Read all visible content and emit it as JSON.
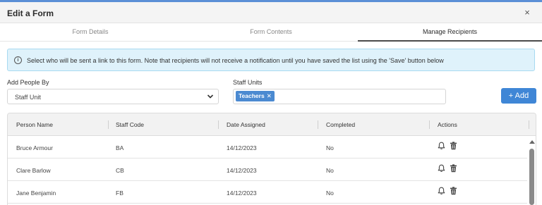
{
  "modal": {
    "title": "Edit a Form",
    "close_label": "×"
  },
  "tabs": [
    {
      "label": "Form Details",
      "active": false
    },
    {
      "label": "Form Contents",
      "active": false
    },
    {
      "label": "Manage Recipients",
      "active": true
    }
  ],
  "info": {
    "icon": "info-circle-icon",
    "text": "Select who will be sent a link to this form. Note that recipients will not receive a notification until you have saved the list using the 'Save' button below"
  },
  "add_people_by": {
    "label": "Add People By",
    "value": "Staff Unit"
  },
  "staff_units": {
    "label": "Staff Units",
    "tags": [
      "Teachers"
    ]
  },
  "add_button": {
    "label": "+ Add"
  },
  "table": {
    "columns": [
      "Person Name",
      "Staff Code",
      "Date Assigned",
      "Completed",
      "Actions"
    ],
    "rows": [
      {
        "name": "Bruce Armour",
        "code": "BA",
        "date": "14/12/2023",
        "completed": "No"
      },
      {
        "name": "Clare Barlow",
        "code": "CB",
        "date": "14/12/2023",
        "completed": "No"
      },
      {
        "name": "Jane Benjamin",
        "code": "FB",
        "date": "14/12/2023",
        "completed": "No"
      }
    ],
    "action_icons": [
      "bell-icon",
      "trash-icon"
    ]
  },
  "colors": {
    "accent": "#3f86d6",
    "tag": "#4b8ad1",
    "info_bg": "#dff2fb",
    "info_border": "#a8daf0"
  }
}
